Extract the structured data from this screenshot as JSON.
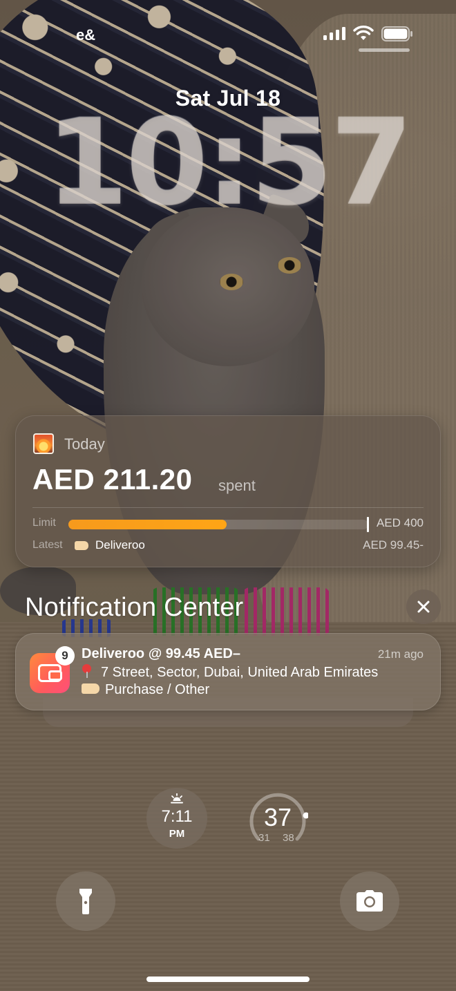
{
  "status_bar": {
    "carrier": "e&"
  },
  "lock_screen": {
    "date": "Sat Jul 18",
    "time": "10:57"
  },
  "spending_widget": {
    "period_label": "Today",
    "amount": "AED 211.20",
    "amount_suffix": "spent",
    "limit_label": "Limit",
    "limit_value": "AED 400",
    "limit_progress_fraction": 0.528,
    "latest_label": "Latest",
    "latest_merchant": "Deliveroo",
    "latest_amount": "AED 99.45-"
  },
  "notification_center": {
    "title": "Notification Center",
    "notification": {
      "badge_count": "9",
      "title": "Deliveroo @ 99.45 AED–",
      "time": "21m ago",
      "location": "7 Street, Sector, Dubai, United Arab Emirates",
      "category": "Purchase / Other"
    }
  },
  "widgets": {
    "sunset_time": "7:11",
    "sunset_period": "PM",
    "temperature": "37",
    "temperature_min": "31",
    "temperature_max": "38"
  },
  "colors": {
    "progress_fill": "#f69a1c",
    "app_icon_gradient_start": "#ff8a3d",
    "app_icon_gradient_end": "#ff4f7a"
  },
  "icons": {
    "flashlight": "flashlight-icon",
    "camera": "camera-icon",
    "close": "close-icon",
    "location": "pin-icon",
    "tag": "tag-icon",
    "sunset": "sunset-icon"
  }
}
